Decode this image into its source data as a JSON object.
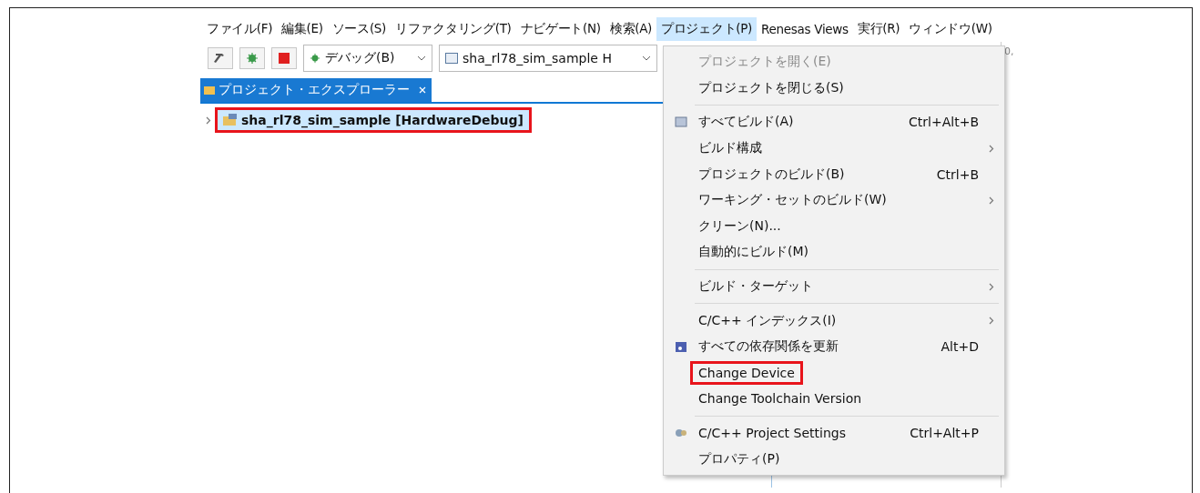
{
  "menubar": [
    {
      "label": "ファイル(F)",
      "selected": false
    },
    {
      "label": "編集(E)",
      "selected": false
    },
    {
      "label": "ソース(S)",
      "selected": false
    },
    {
      "label": "リファクタリング(T)",
      "selected": false
    },
    {
      "label": "ナビゲート(N)",
      "selected": false
    },
    {
      "label": "検索(A)",
      "selected": false
    },
    {
      "label": "プロジェクト(P)",
      "selected": true
    },
    {
      "label": "Renesas Views",
      "selected": false
    },
    {
      "label": "実行(R)",
      "selected": false
    },
    {
      "label": "ウィンドウ(W)",
      "selected": false
    }
  ],
  "toolbar": {
    "buttons": [
      {
        "kind": "build"
      },
      {
        "kind": "debug"
      },
      {
        "kind": "stop"
      }
    ],
    "config_combo": {
      "value": "デバッグ(B)"
    },
    "launch_combo": {
      "value": "sha_rl78_sim_sample H"
    }
  },
  "explorer": {
    "tab": {
      "label": "プロジェクト・エクスプローラー",
      "selected": true
    },
    "tree": [
      {
        "label": "sha_rl78_sim_sample [HardwareDebug]",
        "expanded": false,
        "selected": true,
        "annotated": true
      }
    ]
  },
  "side_text": "0,",
  "menu": {
    "items": [
      {
        "kind": "item",
        "label": "プロジェクトを開く(E)",
        "disabled": true,
        "submenu": false,
        "annotated": false
      },
      {
        "kind": "item",
        "label": "プロジェクトを閉じる(S)",
        "disabled": false,
        "submenu": false,
        "annotated": false
      },
      {
        "kind": "separator"
      },
      {
        "kind": "build",
        "label": "すべてビルド(A)",
        "shortcut": "Ctrl+Alt+B",
        "disabled": false,
        "submenu": false,
        "annotated": false
      },
      {
        "kind": "item",
        "label": "ビルド構成",
        "disabled": false,
        "submenu": true,
        "annotated": false
      },
      {
        "kind": "item",
        "label": "プロジェクトのビルド(B)",
        "shortcut": "Ctrl+B",
        "disabled": false,
        "submenu": false,
        "annotated": false
      },
      {
        "kind": "item",
        "label": "ワーキング・セットのビルド(W)",
        "disabled": false,
        "submenu": true,
        "annotated": false
      },
      {
        "kind": "item",
        "label": "クリーン(N)...",
        "disabled": false,
        "submenu": false,
        "annotated": false
      },
      {
        "kind": "item",
        "label": "自動的にビルド(M)",
        "disabled": false,
        "submenu": false,
        "annotated": false
      },
      {
        "kind": "separator"
      },
      {
        "kind": "item",
        "label": "ビルド・ターゲット",
        "disabled": false,
        "submenu": true,
        "annotated": false
      },
      {
        "kind": "separator"
      },
      {
        "kind": "item",
        "label": "C/C++ インデックス(I)",
        "disabled": false,
        "submenu": true,
        "annotated": false
      },
      {
        "kind": "deps",
        "label": "すべての依存関係を更新",
        "shortcut": "Alt+D",
        "disabled": false,
        "submenu": false,
        "annotated": false
      },
      {
        "kind": "item",
        "label": "Change Device",
        "disabled": false,
        "submenu": false,
        "annotated": true
      },
      {
        "kind": "item",
        "label": "Change Toolchain Version",
        "disabled": false,
        "submenu": false,
        "annotated": false
      },
      {
        "kind": "separator"
      },
      {
        "kind": "settings",
        "label": "C/C++ Project Settings",
        "shortcut": "Ctrl+Alt+P",
        "disabled": false,
        "submenu": false,
        "annotated": false
      },
      {
        "kind": "item",
        "label": "プロパティ(P)",
        "disabled": false,
        "submenu": false,
        "annotated": false
      }
    ]
  }
}
